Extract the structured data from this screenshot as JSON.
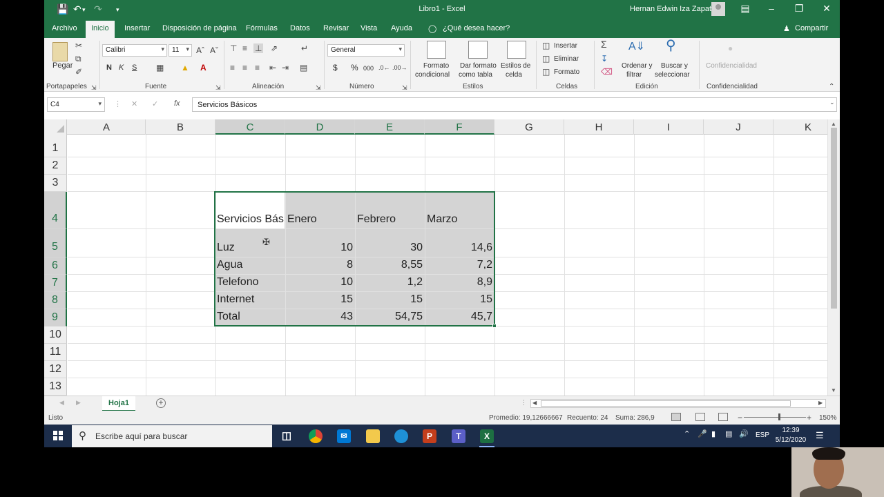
{
  "titlebar": {
    "title": "Libro1 - Excel",
    "user": "Hernan Edwin Iza Zapata"
  },
  "tabs": [
    "Archivo",
    "Inicio",
    "Insertar",
    "Disposición de página",
    "Fórmulas",
    "Datos",
    "Revisar",
    "Vista",
    "Ayuda",
    "¿Qué desea hacer?"
  ],
  "share_label": "Compartir",
  "ribbon": {
    "portapapeles": {
      "paste": "Pegar",
      "label": "Portapapeles"
    },
    "fuente": {
      "font": "Calibri",
      "size": "11",
      "bold": "N",
      "italic": "K",
      "underline": "S",
      "label": "Fuente"
    },
    "alineacion": {
      "label": "Alineación"
    },
    "numero": {
      "format": "General",
      "label": "Número",
      "currency": "$",
      "percent": "%",
      "thousands": "000"
    },
    "estilos": {
      "cond_1": "Formato",
      "cond_2": "condicional",
      "table_1": "Dar formato",
      "table_2": "como tabla",
      "styles_1": "Estilos de",
      "styles_2": "celda",
      "label": "Estilos"
    },
    "celdas": {
      "insert": "Insertar",
      "delete": "Eliminar",
      "format": "Formato",
      "label": "Celdas"
    },
    "edicion": {
      "sort_1": "Ordenar y",
      "sort_2": "filtrar",
      "find_1": "Buscar y",
      "find_2": "seleccionar",
      "label": "Edición"
    },
    "confidencialidad": {
      "button": "Confidencialidad",
      "label": "Confidencialidad"
    }
  },
  "formula_bar": {
    "namebox": "C4",
    "fx": "fx",
    "value": "Servicios Básicos"
  },
  "sheet": {
    "columns": [
      "A",
      "B",
      "C",
      "D",
      "E",
      "F",
      "G",
      "H",
      "I",
      "J",
      "K"
    ],
    "rows": [
      "1",
      "2",
      "3",
      "4",
      "5",
      "6",
      "7",
      "8",
      "9",
      "10",
      "11",
      "12",
      "13"
    ],
    "table": {
      "header": [
        "Servicios Bás",
        "Enero",
        "Febrero",
        "Marzo"
      ],
      "rows": [
        {
          "label": "Luz",
          "enero": "10",
          "febrero": "30",
          "marzo": "14,6"
        },
        {
          "label": "Agua",
          "enero": "8",
          "febrero": "8,55",
          "marzo": "7,2"
        },
        {
          "label": "Telefono",
          "enero": "10",
          "febrero": "1,2",
          "marzo": "8,9"
        },
        {
          "label": "Internet",
          "enero": "15",
          "febrero": "15",
          "marzo": "15"
        },
        {
          "label": "Total",
          "enero": "43",
          "febrero": "54,75",
          "marzo": "45,7"
        }
      ]
    },
    "tab_name": "Hoja1"
  },
  "status": {
    "ready": "Listo",
    "average": "Promedio: 19,12666667",
    "count": "Recuento: 24",
    "sum": "Suma: 286,9",
    "zoom": "150%"
  },
  "taskbar": {
    "search_placeholder": "Escribe aquí para buscar",
    "lang": "ESP",
    "time": "12:39",
    "date": "5/12/2020"
  },
  "colors": {
    "excel_green": "#217346",
    "selection_gray": "#d4d4d4",
    "taskbar": "#1c2d4a"
  }
}
